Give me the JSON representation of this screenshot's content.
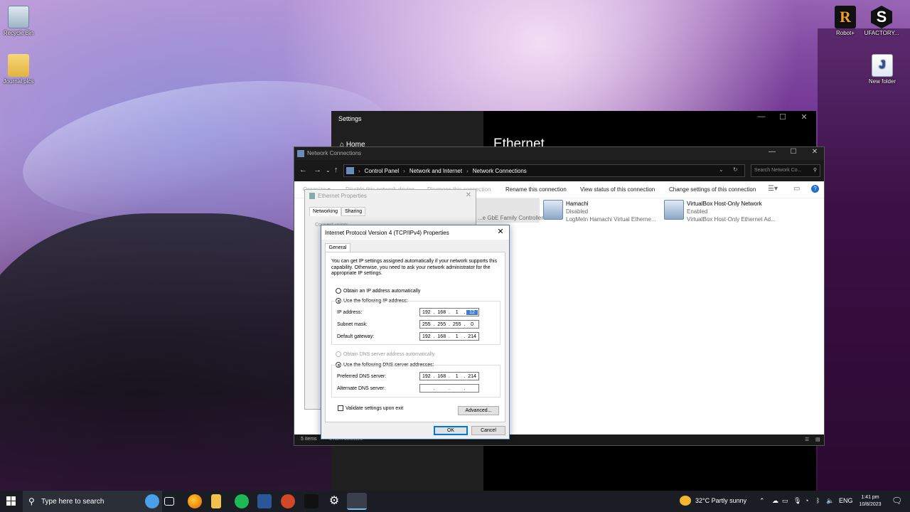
{
  "desktop": {
    "icons": [
      {
        "label": "Recycle Bin"
      },
      {
        "label": "Journal pics"
      },
      {
        "label": "Robot+"
      },
      {
        "label": "UFACTORY..."
      },
      {
        "label": "New folder"
      }
    ]
  },
  "settings": {
    "title": "Settings",
    "home": "Home",
    "heading": "Ethernet"
  },
  "network_connections": {
    "title": "Network Connections",
    "breadcrumbs": [
      "Control Panel",
      "Network and Internet",
      "Network Connections"
    ],
    "search_placeholder": "Search Network Co...",
    "toolbar": {
      "organize": "Organize ▾",
      "disable": "Disable this network device",
      "diagnose": "Diagnose this connection",
      "rename": "Rename this connection",
      "view_status": "View status of this connection",
      "change_settings": "Change settings of this connection"
    },
    "adapters": [
      {
        "name": "",
        "status": "",
        "device": "...e GbE Family Controller"
      },
      {
        "name": "Hamachi",
        "status": "Disabled",
        "device": "LogMeIn Hamachi Virtual Etherne..."
      },
      {
        "name": "VirtualBox Host-Only Network",
        "status": "Enabled",
        "device": "VirtualBox Host-Only Ethernet Ad..."
      }
    ],
    "status_bar": {
      "items": "5 items",
      "selected": "1 item selected"
    }
  },
  "ethernet_properties": {
    "title": "Ethernet Properties",
    "tabs": [
      "Networking",
      "Sharing"
    ],
    "partial_label": "Connect using:"
  },
  "ipv4_dialog": {
    "title": "Internet Protocol Version 4 (TCP/IPv4) Properties",
    "tab": "General",
    "intro": "You can get IP settings assigned automatically if your network supports this capability. Otherwise, you need to ask your network administrator for the appropriate IP settings.",
    "obtain_ip_auto": "Obtain an IP address automatically",
    "use_following_ip": "Use the following IP address:",
    "ip_label": "IP address:",
    "ip": [
      "192",
      "168",
      "1",
      "12"
    ],
    "subnet_label": "Subnet mask:",
    "subnet": [
      "255",
      "255",
      "255",
      "0"
    ],
    "gateway_label": "Default gateway:",
    "gateway": [
      "192",
      "168",
      "1",
      "214"
    ],
    "obtain_dns_auto": "Obtain DNS server address automatically",
    "use_following_dns": "Use the following DNS server addresses:",
    "preferred_dns_label": "Preferred DNS server:",
    "preferred_dns": [
      "192",
      "168",
      "1",
      "214"
    ],
    "alternate_dns_label": "Alternate DNS server:",
    "alternate_dns": [
      "",
      "",
      "",
      ""
    ],
    "validate_label": "Validate settings upon exit",
    "advanced": "Advanced...",
    "ok": "OK",
    "cancel": "Cancel"
  },
  "taskbar": {
    "search_placeholder": "Type here to search",
    "weather": "32°C  Partly sunny",
    "language": "ENG",
    "time": "1:41 pm",
    "date": "10/8/2023"
  }
}
